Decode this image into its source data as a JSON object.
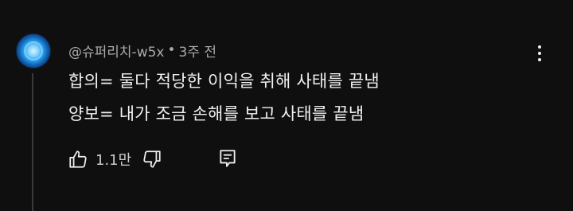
{
  "comment": {
    "author": "@슈퍼리치-w5x",
    "separator": "•",
    "time": "3주 전",
    "lines": [
      "합의= 둘다 적당한 이익을 취해 사태를 끝냄",
      "양보= 내가 조금 손해를 보고 사태를 끝냄"
    ],
    "like_count": "1.1만"
  },
  "icons": {
    "like": "thumbs-up-icon",
    "dislike": "thumbs-down-icon",
    "reply": "reply-icon",
    "menu": "more-vertical-icon",
    "avatar": "avatar"
  },
  "colors": {
    "background": "#0f0f0f",
    "text": "#f1f1f1",
    "meta": "#aaaaaa"
  }
}
